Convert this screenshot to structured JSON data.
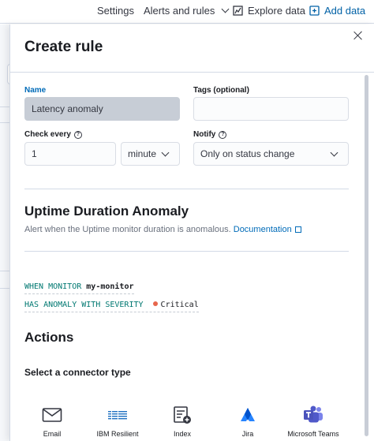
{
  "header": {
    "settings_label": "Settings",
    "alerts_label": "Alerts and rules",
    "explore_label": "Explore data",
    "add_data_label": "Add data"
  },
  "flyout": {
    "title": "Create rule"
  },
  "form": {
    "name_label": "Name",
    "name_value": "Latency anomaly",
    "tags_label": "Tags (optional)",
    "tags_value": "",
    "check_every_label": "Check every",
    "check_every_value": "1",
    "check_every_unit": "minute",
    "notify_label": "Notify",
    "notify_value": "Only on status change"
  },
  "rule": {
    "title": "Uptime Duration Anomaly",
    "description": "Alert when the Uptime monitor duration is anomalous.",
    "doc_link": "Documentation",
    "when_keyword": "WHEN MONITOR",
    "monitor_value": "my-monitor",
    "anomaly_keyword": "HAS ANOMALY WITH SEVERITY",
    "severity_value": "Critical",
    "severity_color": "#e7664c"
  },
  "actions": {
    "title": "Actions",
    "connector_title": "Select a connector type",
    "connectors": [
      {
        "label": "Email",
        "icon": "email-icon"
      },
      {
        "label": "IBM Resilient",
        "icon": "ibm-icon"
      },
      {
        "label": "Index",
        "icon": "index-icon"
      },
      {
        "label": "Jira",
        "icon": "jira-icon"
      },
      {
        "label": "Microsoft Teams",
        "icon": "teams-icon"
      }
    ]
  },
  "colors": {
    "link": "#006bb8",
    "header_link": "#0061a6",
    "keyword": "#007871"
  }
}
